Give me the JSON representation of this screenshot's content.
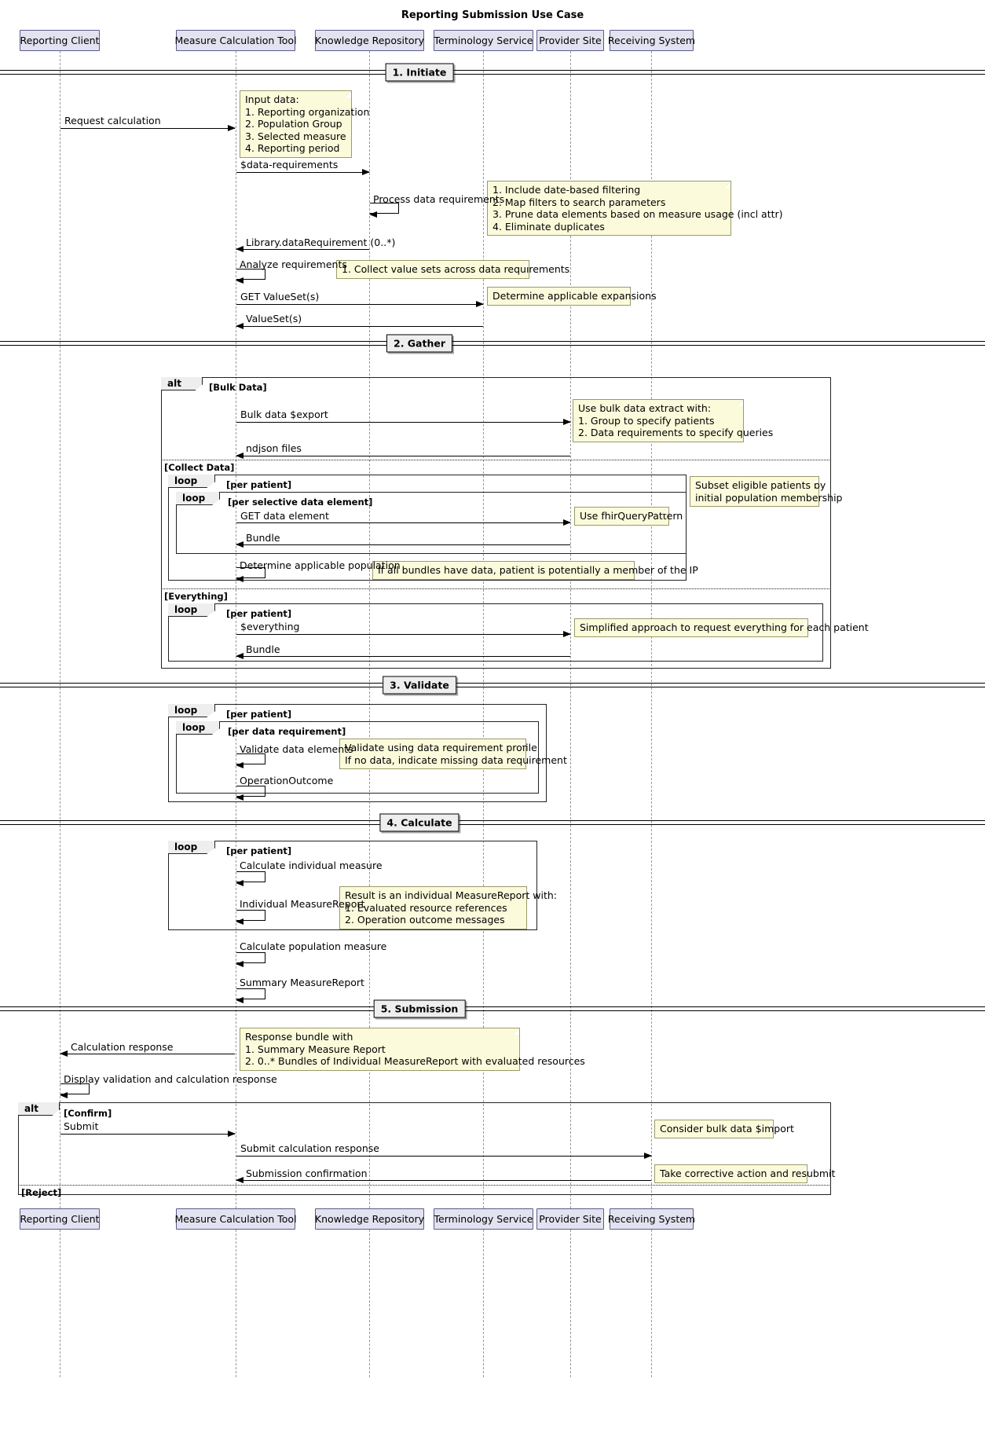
{
  "title": "Reporting Submission Use Case",
  "participants": [
    {
      "id": "client",
      "label": "Reporting Client"
    },
    {
      "id": "mct",
      "label": "Measure Calculation Tool"
    },
    {
      "id": "kr",
      "label": "Knowledge Repository"
    },
    {
      "id": "ts",
      "label": "Terminology Service"
    },
    {
      "id": "ps",
      "label": "Provider Site"
    },
    {
      "id": "rs",
      "label": "Receiving System"
    }
  ],
  "dividers": [
    {
      "id": "d1",
      "label": "1. Initiate"
    },
    {
      "id": "d2",
      "label": "2. Gather"
    },
    {
      "id": "d3",
      "label": "3. Validate"
    },
    {
      "id": "d4",
      "label": "4. Calculate"
    },
    {
      "id": "d5",
      "label": "5. Submission"
    }
  ],
  "messages": [
    {
      "id": "m1",
      "label": "Request calculation"
    },
    {
      "id": "m2",
      "label": "$data-requirements"
    },
    {
      "id": "m3",
      "label": "Process data requirements"
    },
    {
      "id": "m4",
      "label": "Library.dataRequirement (0..*)"
    },
    {
      "id": "m5",
      "label": "Analyze requirements"
    },
    {
      "id": "m6",
      "label": "GET ValueSet(s)"
    },
    {
      "id": "m7",
      "label": "ValueSet(s)"
    },
    {
      "id": "m8",
      "label": "Bulk data $export"
    },
    {
      "id": "m9",
      "label": "ndjson files"
    },
    {
      "id": "m10",
      "label": "GET data element"
    },
    {
      "id": "m11",
      "label": "Bundle"
    },
    {
      "id": "m12",
      "label": "Determine applicable population"
    },
    {
      "id": "m13",
      "label": "$everything"
    },
    {
      "id": "m14",
      "label": "Bundle"
    },
    {
      "id": "m15",
      "label": "Validate data elements"
    },
    {
      "id": "m16",
      "label": "OperationOutcome"
    },
    {
      "id": "m17",
      "label": "Calculate individual measure"
    },
    {
      "id": "m18",
      "label": "Individual MeasureReport"
    },
    {
      "id": "m19",
      "label": "Calculate population measure"
    },
    {
      "id": "m20",
      "label": "Summary MeasureReport"
    },
    {
      "id": "m21",
      "label": "Calculation response"
    },
    {
      "id": "m22",
      "label": "Display validation and calculation response"
    },
    {
      "id": "m23",
      "label": "Submit"
    },
    {
      "id": "m24",
      "label": "Submit calculation response"
    },
    {
      "id": "m25",
      "label": "Submission confirmation"
    }
  ],
  "notes": [
    {
      "id": "n1",
      "text": "Input data:\n1. Reporting organization\n2. Population Group\n3. Selected measure\n4. Reporting period"
    },
    {
      "id": "n2",
      "text": "1. Include date-based filtering\n2. Map filters to search parameters\n3. Prune data elements based on measure usage (incl attr)\n4. Eliminate duplicates"
    },
    {
      "id": "n3",
      "text": "1. Collect value sets across data requirements"
    },
    {
      "id": "n4",
      "text": "Determine applicable expansions"
    },
    {
      "id": "n5",
      "text": "Use bulk data extract with:\n1. Group to specify patients\n2. Data requirements to specify queries"
    },
    {
      "id": "n6",
      "text": "Subset eligible patients by\ninitial population membership"
    },
    {
      "id": "n7",
      "text": "Use fhirQueryPattern"
    },
    {
      "id": "n8",
      "text": "If all bundles have data, patient is potentially a member of the IP"
    },
    {
      "id": "n9",
      "text": "Simplified approach to request everything for each patient"
    },
    {
      "id": "n10",
      "text": "Validate using data requirement profile\nIf no data, indicate missing data requirement"
    },
    {
      "id": "n11",
      "text": "Result is an individual MeasureReport with:\n1. Evaluated resource references\n2. Operation outcome messages"
    },
    {
      "id": "n12",
      "text": "Response bundle with\n1. Summary Measure Report\n2. 0..* Bundles of Individual MeasureReport with evaluated resources"
    },
    {
      "id": "n13",
      "text": "Consider bulk data $import"
    },
    {
      "id": "n14",
      "text": "Take corrective action and resubmit"
    }
  ],
  "fragments": [
    {
      "id": "f1",
      "operator": "alt",
      "condition": "[Bulk Data]"
    },
    {
      "id": "f1b",
      "condition": "[Collect Data]"
    },
    {
      "id": "f1c",
      "condition": "[Everything]"
    },
    {
      "id": "f2",
      "operator": "loop",
      "condition": "[per patient]"
    },
    {
      "id": "f3",
      "operator": "loop",
      "condition": "[per selective data element]"
    },
    {
      "id": "f4",
      "operator": "loop",
      "condition": "[per patient]"
    },
    {
      "id": "f5",
      "operator": "loop",
      "condition": "[per patient]"
    },
    {
      "id": "f6",
      "operator": "loop",
      "condition": "[per data requirement]"
    },
    {
      "id": "f7",
      "operator": "loop",
      "condition": "[per patient]"
    },
    {
      "id": "f8",
      "operator": "alt",
      "condition": "[Confirm]"
    },
    {
      "id": "f8b",
      "condition": "[Reject]"
    }
  ],
  "colors": {
    "participant_fill": "#E2E2F0",
    "participant_border": "#5B5B8A",
    "note_fill": "#FBFBDB",
    "note_border": "#9A9A6A",
    "divider_fill": "#EEEEEE"
  }
}
